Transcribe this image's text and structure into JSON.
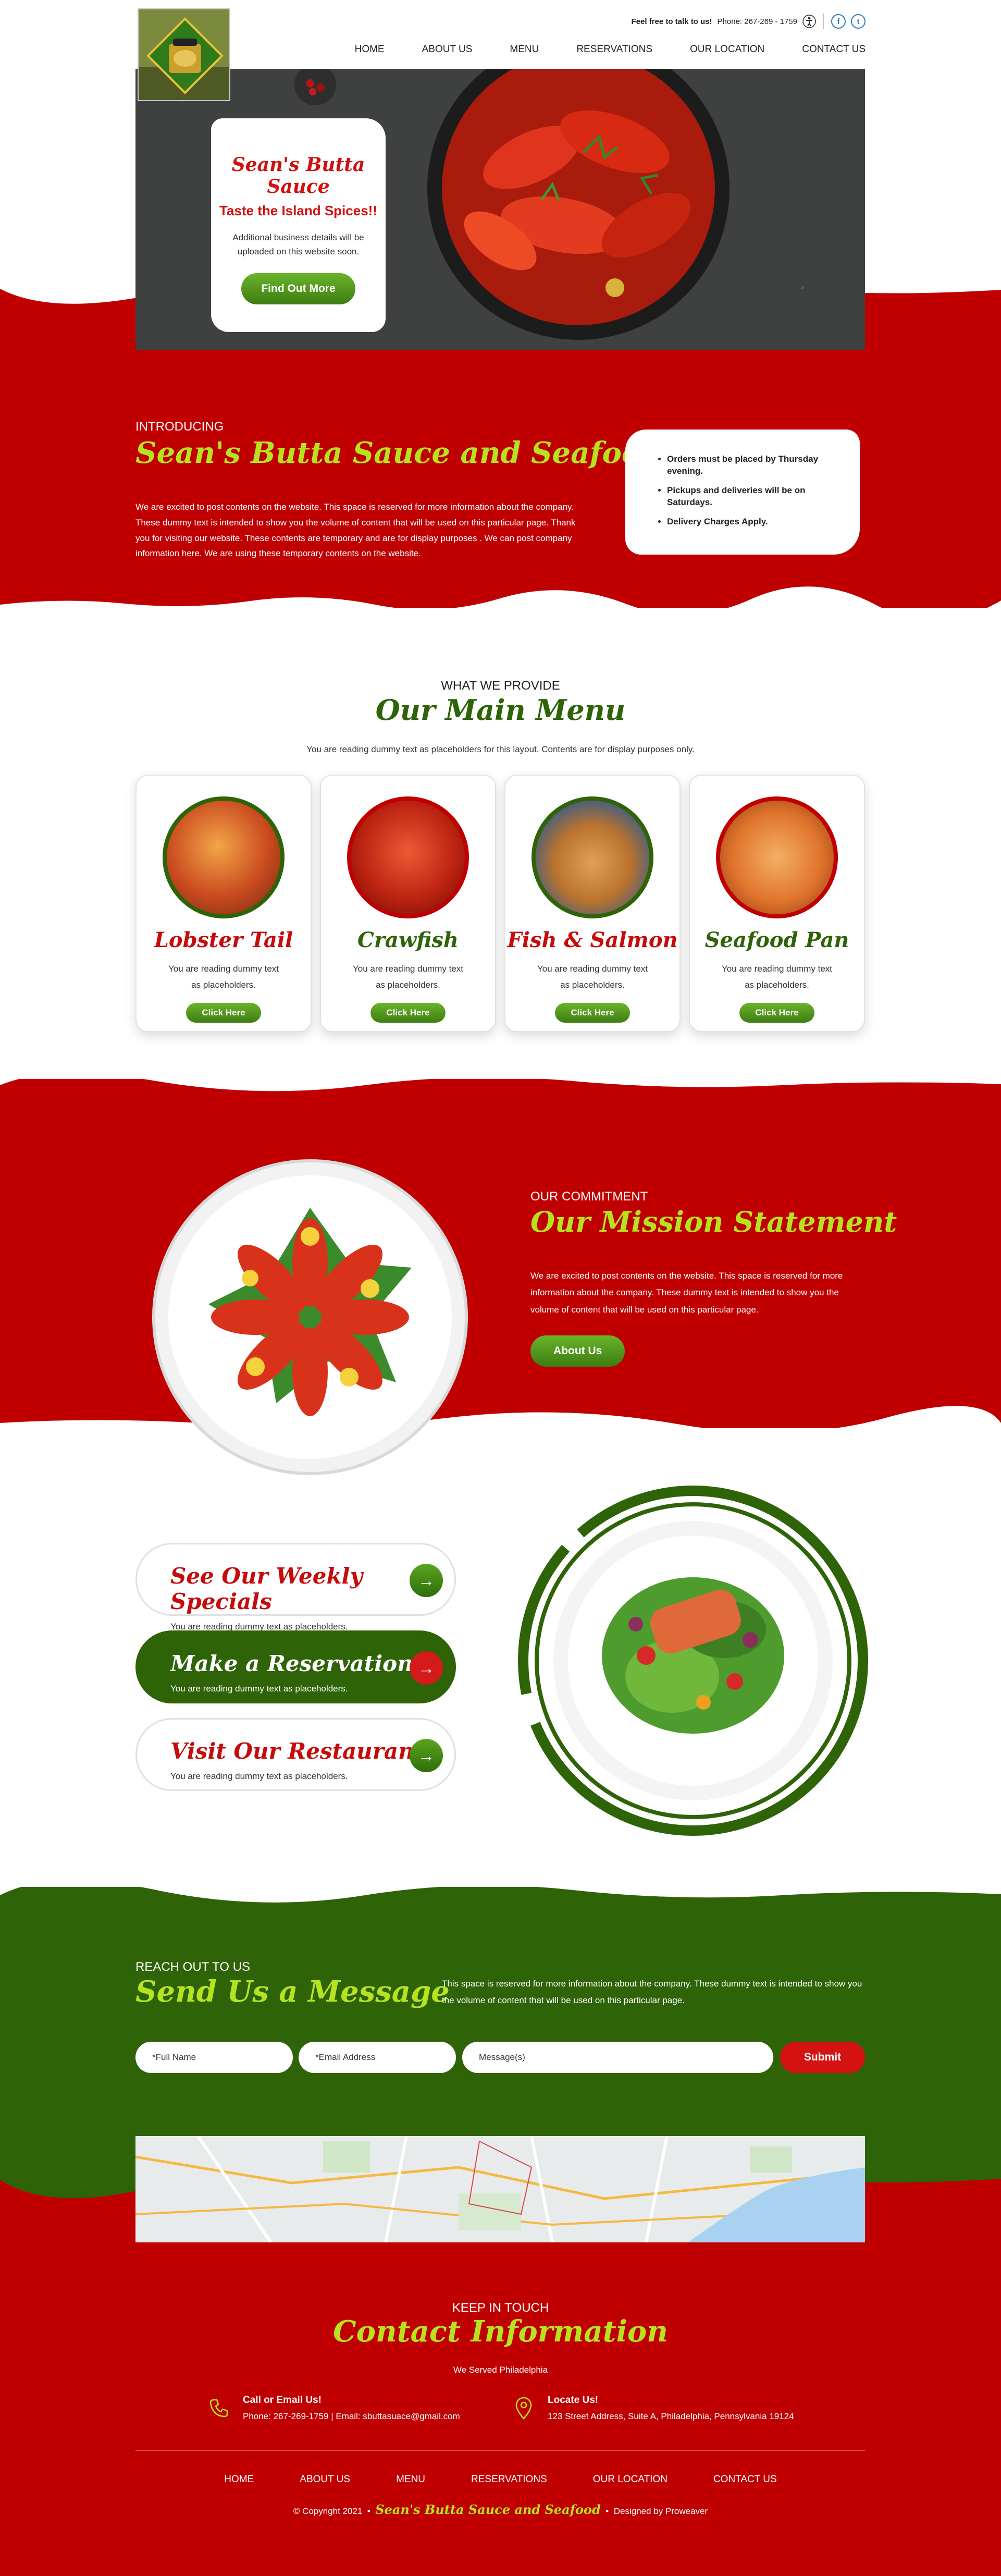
{
  "header": {
    "logo_alt": "Sean's Butta Sauce logo",
    "contact_lead": "Feel free to talk to us!",
    "phone_label": "Phone: 267-269 - 1759",
    "social": {
      "facebook": "f",
      "twitter": "t"
    },
    "nav": [
      "HOME",
      "ABOUT US",
      "MENU",
      "RESERVATIONS",
      "OUR LOCATION",
      "CONTACT US"
    ]
  },
  "hero": {
    "title": "Sean's Butta Sauce",
    "subtitle": "Taste the Island Spices!!",
    "text": "Additional business details will be uploaded on this website soon.",
    "button": "Find Out More"
  },
  "intro": {
    "kicker": "INTRODUCING",
    "title": "Sean's Butta Sauce and Seafood",
    "text": "We are excited to post contents on the website. This space is reserved for more information about the company. These dummy text is intended to show you the volume of content that will be used on this particular page. Thank you for visiting our website. These contents are temporary and are for display purposes . We can post company information here. We are using these temporary contents on the website.",
    "notices": [
      "Orders must be placed by Thursday evening.",
      "Pickups and deliveries will be on Saturdays.",
      "Delivery Charges Apply."
    ]
  },
  "menu": {
    "kicker": "WHAT WE PROVIDE",
    "title": "Our Main Menu",
    "subtitle": "You are reading dummy text as placeholders for this layout. Contents are for display purposes only.",
    "items": [
      {
        "title": "Lobster Tail",
        "text": "You are reading dummy text as placeholders.",
        "button": "Click Here"
      },
      {
        "title": "Crawfish",
        "text": "You are reading dummy text as placeholders.",
        "button": "Click Here"
      },
      {
        "title": "Fish & Salmon",
        "text": "You are reading dummy text as placeholders.",
        "button": "Click Here"
      },
      {
        "title": "Seafood Pan",
        "text": "You are reading dummy text as placeholders.",
        "button": "Click Here"
      }
    ]
  },
  "mission": {
    "kicker": "OUR COMMITMENT",
    "title": "Our Mission Statement",
    "text": "We are excited to post contents on the website. This space is reserved for more information about the company. These dummy text is intended to show you the volume of content that will be used on this particular page.",
    "button": "About Us"
  },
  "links": [
    {
      "title": "See Our Weekly Specials",
      "text": "You are reading dummy text as placeholders."
    },
    {
      "title": "Make a Reservation",
      "text": "You are reading dummy text as placeholders."
    },
    {
      "title": "Visit Our Restaurant",
      "text": "You are reading dummy text as placeholders."
    }
  ],
  "message": {
    "kicker": "REACH OUT TO US",
    "title": "Send Us a Message",
    "text": "This space is reserved for more information about the company. These dummy text is intended to show you the volume of content that will be used on this particular page.",
    "name_placeholder": "*Full Name",
    "email_placeholder": "*Email Address",
    "message_placeholder": "Message(s)",
    "submit": "Submit"
  },
  "contact": {
    "kicker": "KEEP IN TOUCH",
    "title": "Contact Information",
    "served": "We Served  Philadelphia",
    "call_heading": "Call or Email Us!",
    "call_value": "Phone: 267-269-1759  |  Email: sbuttasuace@gmail.com",
    "locate_heading": "Locate Us!",
    "locate_value": "123 Street Address, Suite A, Philadelphia, Pennsylvania 19124"
  },
  "footer": {
    "nav": [
      "HOME",
      "ABOUT US",
      "MENU",
      "RESERVATIONS",
      "OUR LOCATION",
      "CONTACT US"
    ],
    "copyright": "© Copyright 2021",
    "brand": "Sean's Butta Sauce and Seafood",
    "designed": "Designed by Proweaver"
  },
  "colors": {
    "red": "#c00000",
    "green": "#2e6308",
    "lime": "#b6e31f",
    "button_green": "#4e951c"
  }
}
